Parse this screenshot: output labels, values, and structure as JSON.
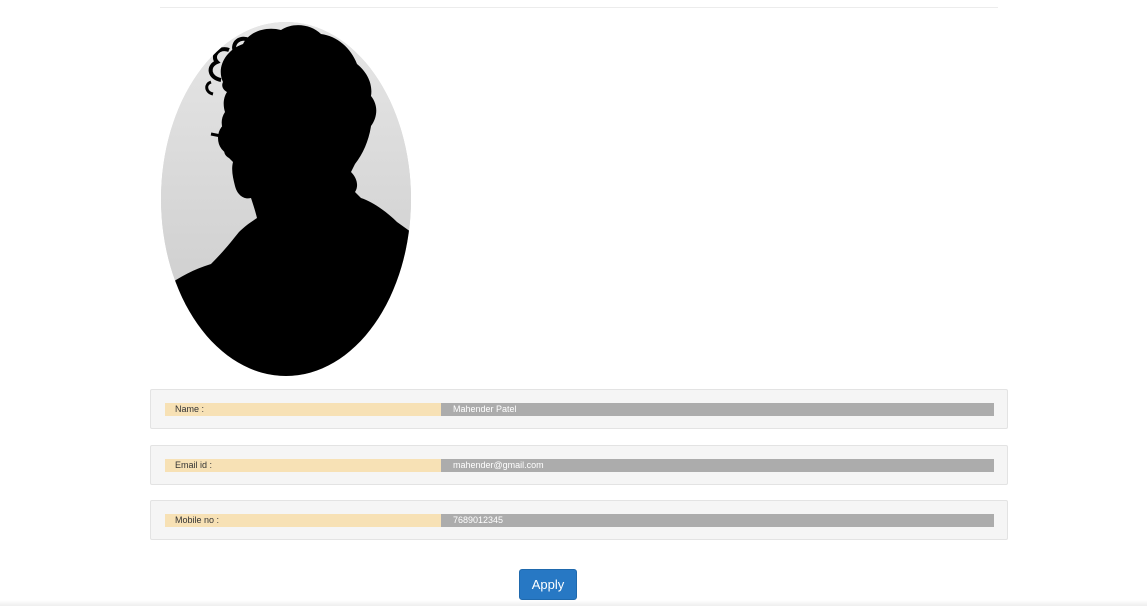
{
  "profile": {
    "fields": [
      {
        "label": "Name :",
        "value": "Mahender Patel"
      },
      {
        "label": "Email id :",
        "value": "mahender@gmail.com"
      },
      {
        "label": "Mobile no :",
        "value": "7689012345"
      }
    ]
  },
  "actions": {
    "apply_label": "Apply"
  },
  "colors": {
    "label_bg": "#f7e1b5",
    "value_bg": "#acacac",
    "button_bg": "#2778c4",
    "panel_bg": "#f5f5f5"
  },
  "icons": {
    "avatar": "profile-photo-silhouette"
  }
}
